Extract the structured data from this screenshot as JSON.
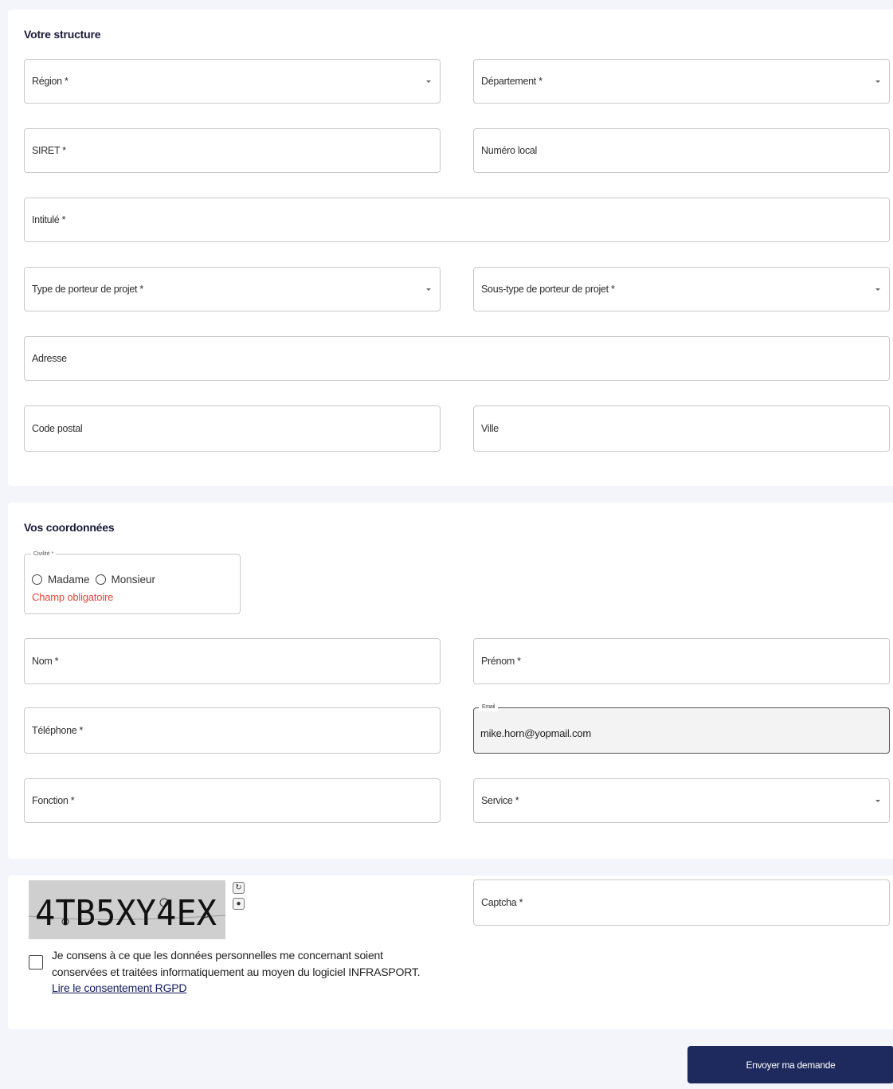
{
  "structure": {
    "title": "Votre structure",
    "region": "Région *",
    "departement": "Département *",
    "siret": "SIRET *",
    "numero_local": "Numéro local",
    "intitule": "Intitulé *",
    "type_porteur": "Type de porteur de projet *",
    "sous_type_porteur": "Sous-type de porteur de projet *",
    "adresse": "Adresse",
    "code_postal": "Code postal",
    "ville": "Ville"
  },
  "coordonnees": {
    "title": "Vos coordonnées",
    "civilite_label": "Civilité *",
    "madame": "Madame",
    "monsieur": "Monsieur",
    "civilite_error": "Champ obligatoire",
    "nom": "Nom *",
    "prenom": "Prénom *",
    "telephone": "Téléphone *",
    "email_label": "Email",
    "email_value": "mike.horn@yopmail.com",
    "fonction": "Fonction *",
    "service": "Service *"
  },
  "captcha": {
    "image_text": "4TB5XY4EX",
    "input_label": "Captcha *",
    "refresh_icon": "refresh-icon",
    "audio_icon": "audio-icon"
  },
  "consent": {
    "line1": "Je consens à ce que les données personnelles me concernant soient",
    "line2": "conservées et traitées informatiquement au moyen du logiciel INFRASPORT.",
    "link": "Lire le consentement RGPD"
  },
  "submit_label": "Envoyer ma demande",
  "colors": {
    "page_bg": "#f4f5fb",
    "primary": "#1e2a5e",
    "error": "#e4463d"
  }
}
